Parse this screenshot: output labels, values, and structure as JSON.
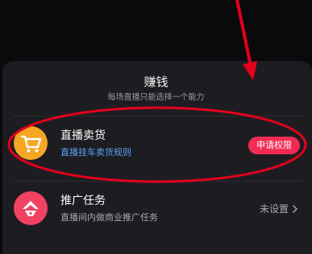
{
  "sheet": {
    "title": "赚钱",
    "subtitle": "每场直播只能选择一个能力"
  },
  "options": [
    {
      "title": "直播卖货",
      "description": "直播挂车卖货规则",
      "action_label": "申请权限",
      "icon": "shopping-cart-icon"
    },
    {
      "title": "推广任务",
      "description": "直播间内做商业推广任务",
      "status": "未设置",
      "icon": "megaphone-icon"
    }
  ],
  "colors": {
    "accent": "#f12b55",
    "link": "#5aa2f5",
    "annotation": "#e4001b",
    "cart_bg": "#f5a623",
    "promo_bg": "#f24262",
    "sheet_bg": "#1d1d21"
  }
}
